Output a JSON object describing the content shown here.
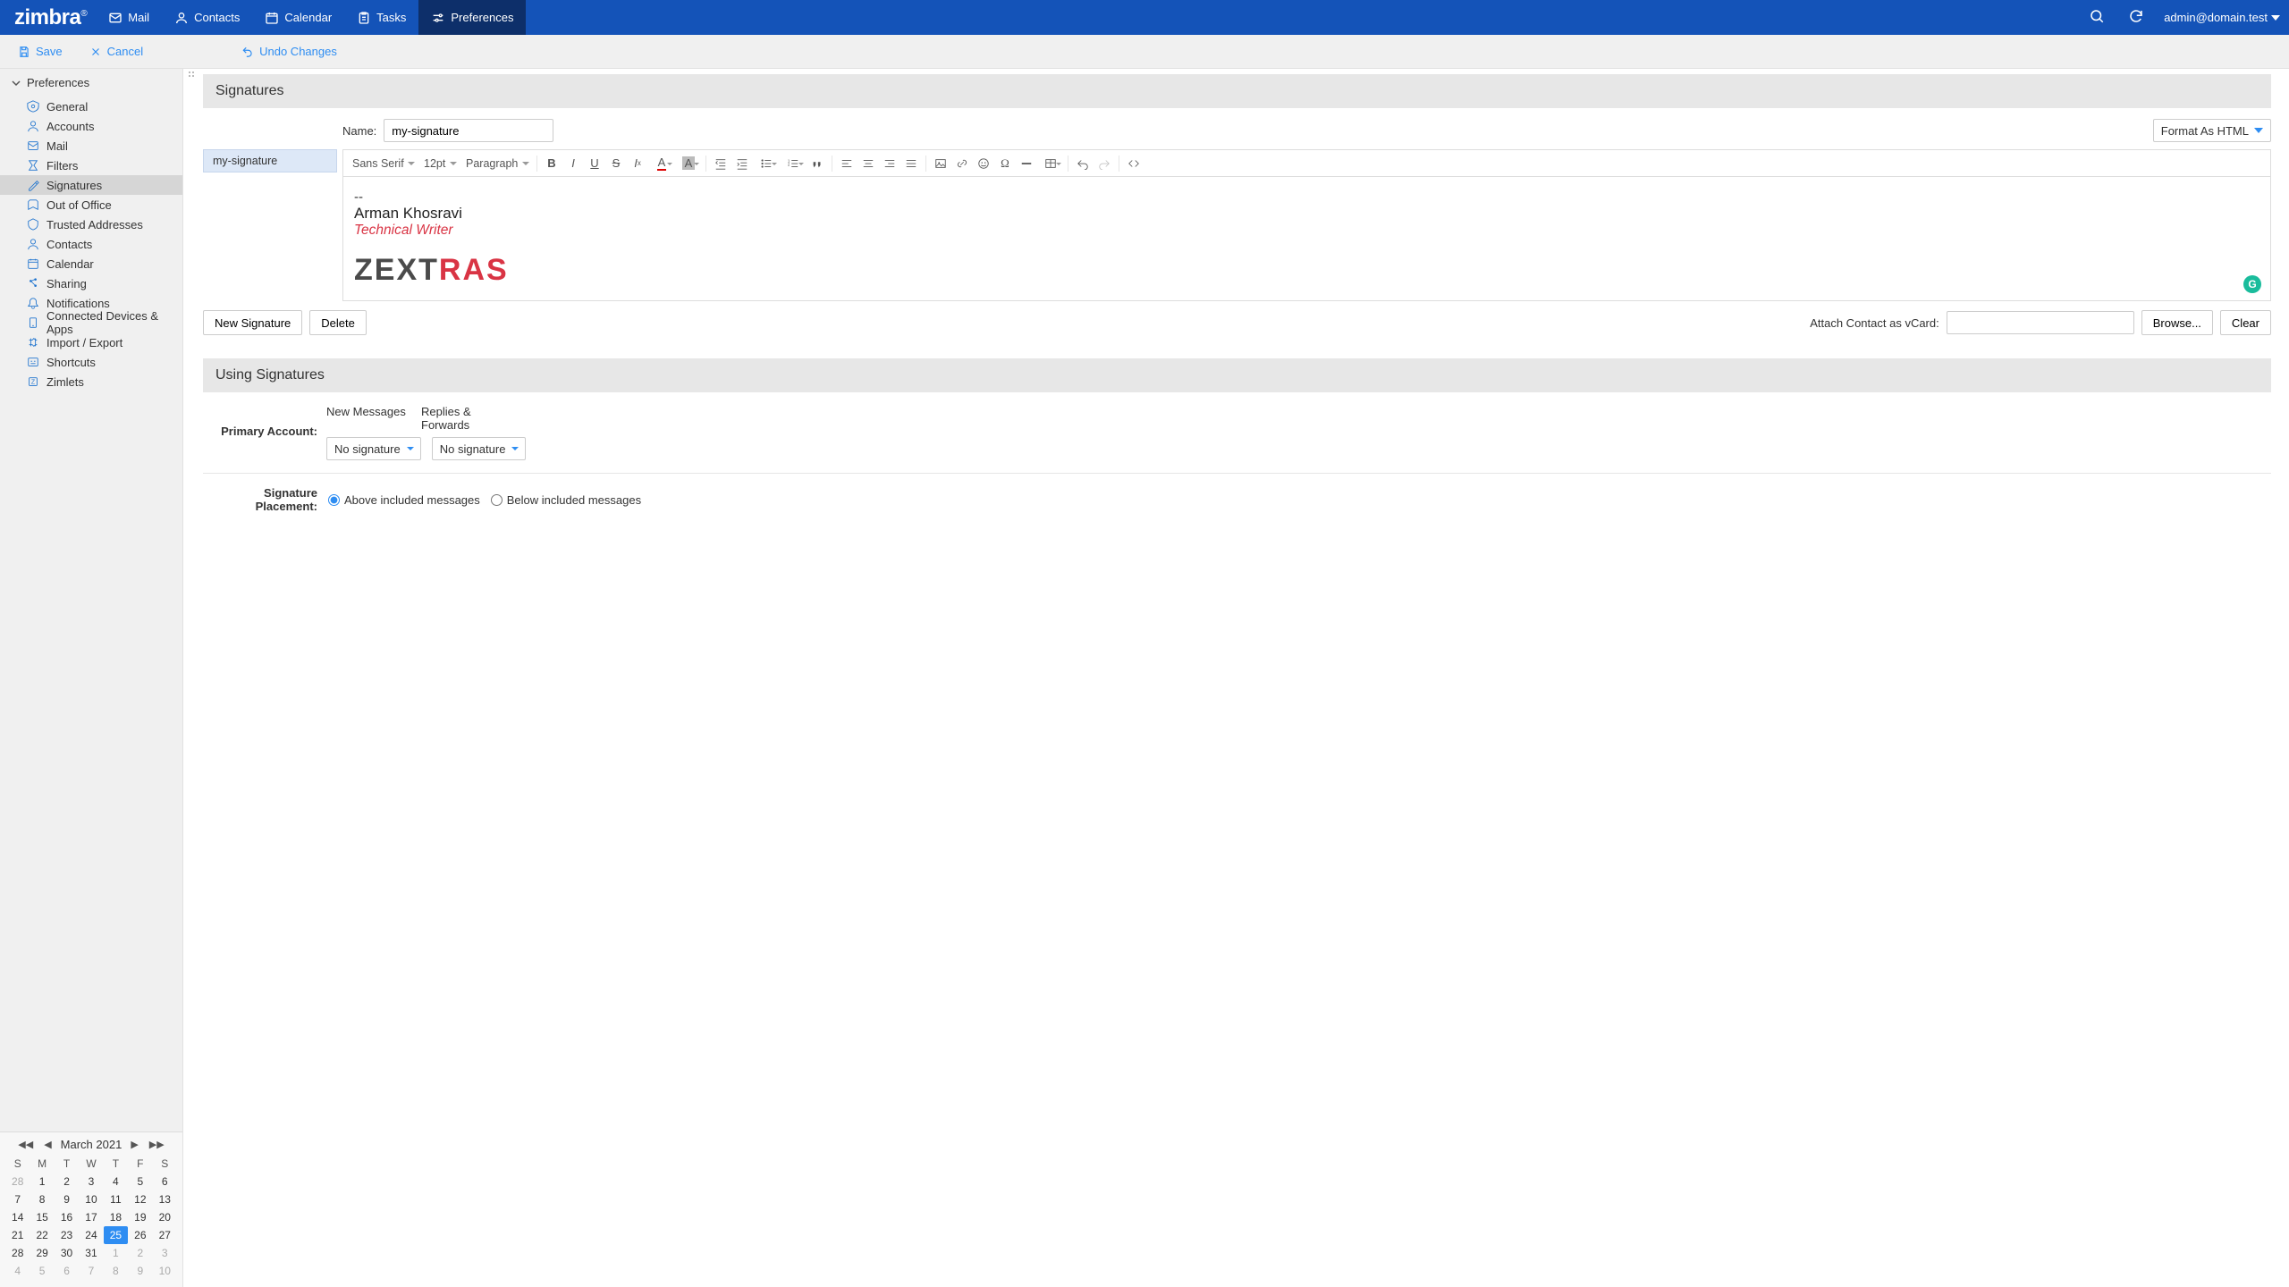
{
  "brand": "zimbra",
  "nav": {
    "mail": "Mail",
    "contacts": "Contacts",
    "calendar": "Calendar",
    "tasks": "Tasks",
    "preferences": "Preferences"
  },
  "user": "admin@domain.test",
  "toolbar": {
    "save": "Save",
    "cancel": "Cancel",
    "undo": "Undo Changes"
  },
  "sidebar": {
    "header": "Preferences",
    "items": [
      {
        "label": "General"
      },
      {
        "label": "Accounts"
      },
      {
        "label": "Mail"
      },
      {
        "label": "Filters"
      },
      {
        "label": "Signatures"
      },
      {
        "label": "Out of Office"
      },
      {
        "label": "Trusted Addresses"
      },
      {
        "label": "Contacts"
      },
      {
        "label": "Calendar"
      },
      {
        "label": "Sharing"
      },
      {
        "label": "Notifications"
      },
      {
        "label": "Connected Devices & Apps"
      },
      {
        "label": "Import / Export"
      },
      {
        "label": "Shortcuts"
      },
      {
        "label": "Zimlets"
      }
    ]
  },
  "miniCal": {
    "title": "March 2021",
    "dow": [
      "S",
      "M",
      "T",
      "W",
      "T",
      "F",
      "S"
    ],
    "weeks": [
      [
        {
          "d": "28",
          "dim": true
        },
        {
          "d": "1"
        },
        {
          "d": "2"
        },
        {
          "d": "3"
        },
        {
          "d": "4"
        },
        {
          "d": "5"
        },
        {
          "d": "6"
        }
      ],
      [
        {
          "d": "7"
        },
        {
          "d": "8"
        },
        {
          "d": "9"
        },
        {
          "d": "10"
        },
        {
          "d": "11"
        },
        {
          "d": "12"
        },
        {
          "d": "13"
        }
      ],
      [
        {
          "d": "14"
        },
        {
          "d": "15"
        },
        {
          "d": "16"
        },
        {
          "d": "17"
        },
        {
          "d": "18"
        },
        {
          "d": "19"
        },
        {
          "d": "20"
        }
      ],
      [
        {
          "d": "21"
        },
        {
          "d": "22"
        },
        {
          "d": "23"
        },
        {
          "d": "24"
        },
        {
          "d": "25",
          "today": true
        },
        {
          "d": "26"
        },
        {
          "d": "27"
        }
      ],
      [
        {
          "d": "28"
        },
        {
          "d": "29"
        },
        {
          "d": "30"
        },
        {
          "d": "31"
        },
        {
          "d": "1",
          "dim": true
        },
        {
          "d": "2",
          "dim": true
        },
        {
          "d": "3",
          "dim": true
        }
      ],
      [
        {
          "d": "4",
          "dim": true
        },
        {
          "d": "5",
          "dim": true
        },
        {
          "d": "6",
          "dim": true
        },
        {
          "d": "7",
          "dim": true
        },
        {
          "d": "8",
          "dim": true
        },
        {
          "d": "9",
          "dim": true
        },
        {
          "d": "10",
          "dim": true
        }
      ]
    ]
  },
  "sections": {
    "signatures": "Signatures",
    "using": "Using Signatures"
  },
  "signature": {
    "nameLabel": "Name:",
    "nameValue": "my-signature",
    "formatBtn": "Format As HTML",
    "listItem": "my-signature",
    "font": "Sans Serif",
    "size": "12pt",
    "block": "Paragraph",
    "content": {
      "dash": "--",
      "name": "Arman Khosravi",
      "role": "Technical Writer",
      "logoGrey": "ZEXT",
      "logoRed": "RAS"
    },
    "newSig": "New Signature",
    "delete": "Delete",
    "vcardLabel": "Attach Contact as vCard:",
    "browse": "Browse...",
    "clear": "Clear"
  },
  "using": {
    "colNew": "New Messages",
    "colReply": "Replies & Forwards",
    "primaryLabel": "Primary Account:",
    "noSigNew": "No signature",
    "noSigReply": "No signature",
    "placementLabel": "Signature Placement:",
    "optAbove": "Above included messages",
    "optBelow": "Below included messages"
  }
}
